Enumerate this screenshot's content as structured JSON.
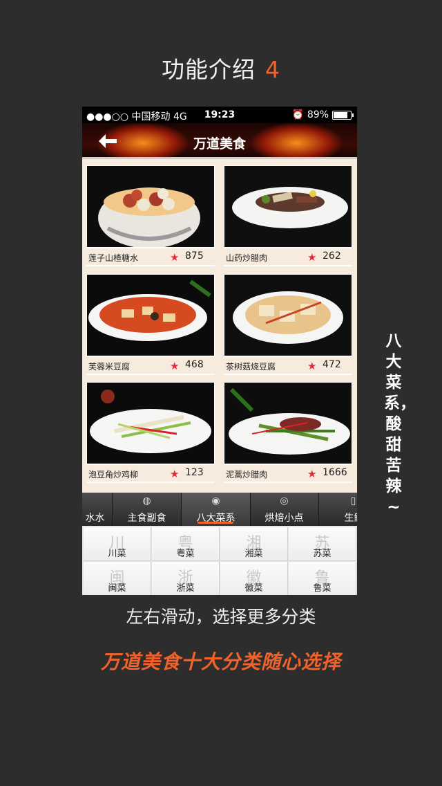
{
  "headline": {
    "text": "功能介绍",
    "number": "4"
  },
  "status": {
    "carrier": "●●●○○ 中国移动  4G",
    "time": "19:23",
    "battery": "89%",
    "battery_level": 0.89
  },
  "nav": {
    "title": "万道美食"
  },
  "dishes": [
    {
      "name": "莲子山楂糖水",
      "count": "875"
    },
    {
      "name": "山药炒腊肉",
      "count": "262"
    },
    {
      "name": "芙蓉米豆腐",
      "count": "468"
    },
    {
      "name": "茶树菇烧豆腐",
      "count": "472"
    },
    {
      "name": "泡豆角炒鸡柳",
      "count": "123"
    },
    {
      "name": "泥蒿炒腊肉",
      "count": "1666"
    }
  ],
  "tabs": [
    {
      "label": "水水",
      "icon": "drink-icon"
    },
    {
      "label": "主食副食",
      "icon": "bowl-icon"
    },
    {
      "label": "八大菜系",
      "icon": "pot-icon",
      "active": true
    },
    {
      "label": "烘焙小点",
      "icon": "cake-icon"
    },
    {
      "label": "生鲜蔬",
      "icon": "cup-icon"
    }
  ],
  "cuisines": [
    {
      "big": "川",
      "label": "川菜"
    },
    {
      "big": "粤",
      "label": "粤菜"
    },
    {
      "big": "湘",
      "label": "湘菜"
    },
    {
      "big": "苏",
      "label": "苏菜"
    },
    {
      "big": "闽",
      "label": "闽菜"
    },
    {
      "big": "浙",
      "label": "浙菜"
    },
    {
      "big": "徽",
      "label": "徽菜"
    },
    {
      "big": "鲁",
      "label": "鲁菜"
    }
  ],
  "side_text": "八大菜系，酸甜苦辣~",
  "swipe_text": "左右滑动，选择更多分类",
  "slogan": "万道美食十大分类随心选择",
  "colors": {
    "accent": "#f0622a",
    "star": "#e8263f",
    "background": "#2d2d2d"
  }
}
